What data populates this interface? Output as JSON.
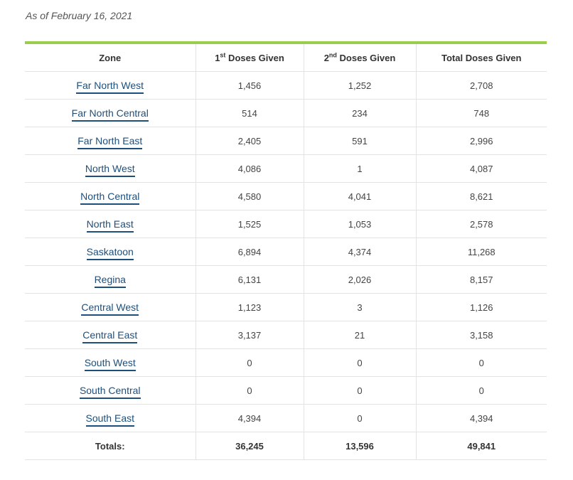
{
  "as_of": "As of February 16, 2021",
  "header": {
    "zone": "Zone",
    "first_num": "1",
    "first_sup": "st",
    "first_rest": " Doses Given",
    "second_num": "2",
    "second_sup": "nd",
    "second_rest": " Doses Given",
    "total": "Total Doses Given"
  },
  "rows": [
    {
      "zone": "Far North West",
      "first": "1,456",
      "second": "1,252",
      "total": "2,708"
    },
    {
      "zone": "Far North Central",
      "first": "514",
      "second": "234",
      "total": "748"
    },
    {
      "zone": "Far North East",
      "first": "2,405",
      "second": "591",
      "total": "2,996"
    },
    {
      "zone": "North West",
      "first": "4,086",
      "second": "1",
      "total": "4,087"
    },
    {
      "zone": "North Central",
      "first": "4,580",
      "second": "4,041",
      "total": "8,621"
    },
    {
      "zone": "North East",
      "first": "1,525",
      "second": "1,053",
      "total": "2,578"
    },
    {
      "zone": "Saskatoon",
      "first": "6,894",
      "second": "4,374",
      "total": "11,268"
    },
    {
      "zone": "Regina",
      "first": "6,131",
      "second": "2,026",
      "total": "8,157"
    },
    {
      "zone": "Central West",
      "first": "1,123",
      "second": "3",
      "total": "1,126"
    },
    {
      "zone": "Central East",
      "first": "3,137",
      "second": "21",
      "total": "3,158"
    },
    {
      "zone": "South West",
      "first": "0",
      "second": "0",
      "total": "0"
    },
    {
      "zone": "South Central",
      "first": "0",
      "second": "0",
      "total": "0"
    },
    {
      "zone": "South East",
      "first": "4,394",
      "second": "0",
      "total": "4,394"
    }
  ],
  "totals": {
    "label": "Totals:",
    "first": "36,245",
    "second": "13,596",
    "total": "49,841"
  },
  "colors": {
    "accent_rule": "#9acd4a",
    "link": "#1d4f7c"
  }
}
